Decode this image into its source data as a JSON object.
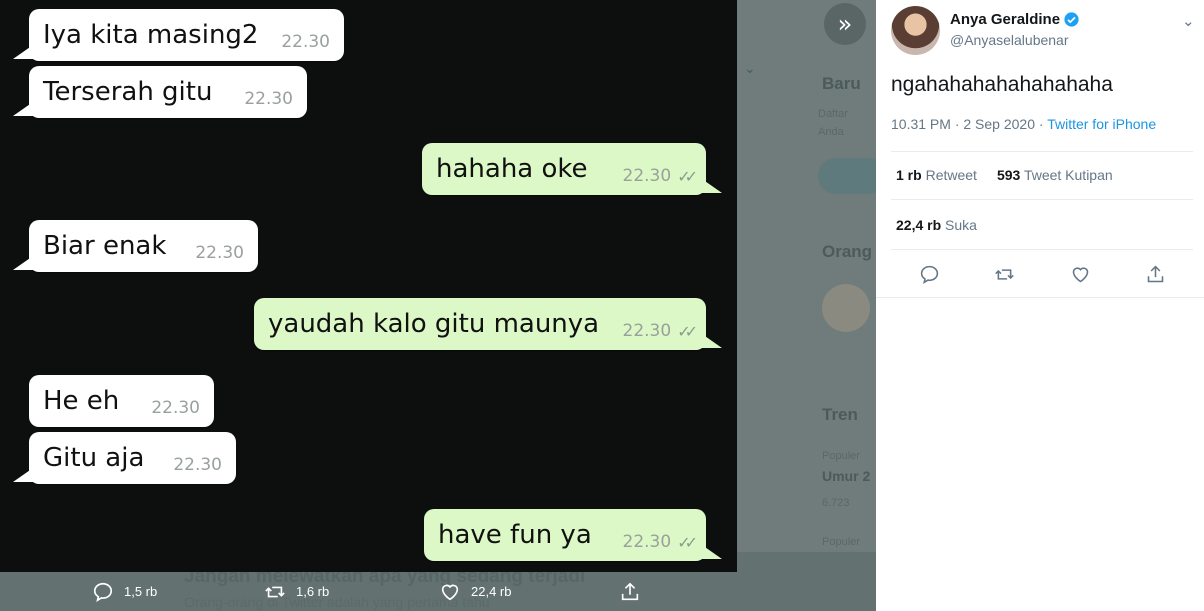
{
  "background": {
    "headings": [
      "Baru",
      "Orang",
      "Tren"
    ],
    "small_lines": [
      "Daftar",
      "Anda",
      "Populer",
      "Umur 2",
      "6.723",
      "Populer"
    ],
    "banner_title": "Jangan melewatkan apa yang sedang terjadi",
    "banner_subtitle": "Orang-orang di Twitter adalah yang pertama tahu"
  },
  "chat": {
    "messages": [
      {
        "text": "Iya kita masing2",
        "time": "22.30",
        "dir": "in"
      },
      {
        "text": "Terserah gitu",
        "time": "22.30",
        "dir": "in"
      },
      {
        "text": "hahaha oke",
        "time": "22.30",
        "dir": "out"
      },
      {
        "text": "Biar enak",
        "time": "22.30",
        "dir": "in"
      },
      {
        "text": "yaudah kalo gitu maunya",
        "time": "22.30",
        "dir": "out"
      },
      {
        "text": "He eh",
        "time": "22.30",
        "dir": "in"
      },
      {
        "text": "Gitu aja",
        "time": "22.30",
        "dir": "in"
      },
      {
        "text": "have fun ya",
        "time": "22.30",
        "dir": "out"
      }
    ],
    "read_ticks": "✓✓"
  },
  "collapse_icon": "»",
  "media_actions": {
    "replies": "1,5 rb",
    "retweets": "1,6 rb",
    "likes": "22,4 rb"
  },
  "tweet": {
    "author_name": "Anya Geraldine",
    "handle": "@Anyaselalubenar",
    "text": "ngahahahahahahahaha",
    "time": "10.31 PM · 2 Sep 2020 ·",
    "source": "Twitter for iPhone",
    "retweets_count": "1 rb",
    "retweets_label": "Retweet",
    "quotes_count": "593",
    "quotes_label": "Tweet Kutipan",
    "likes_count": "22,4 rb",
    "likes_label": "Suka",
    "more_icon": "⌄"
  },
  "colors": {
    "incoming": "#ffffff",
    "outgoing": "#dcf8c6",
    "link": "#1b95e0",
    "verified": "#1da1f2"
  }
}
